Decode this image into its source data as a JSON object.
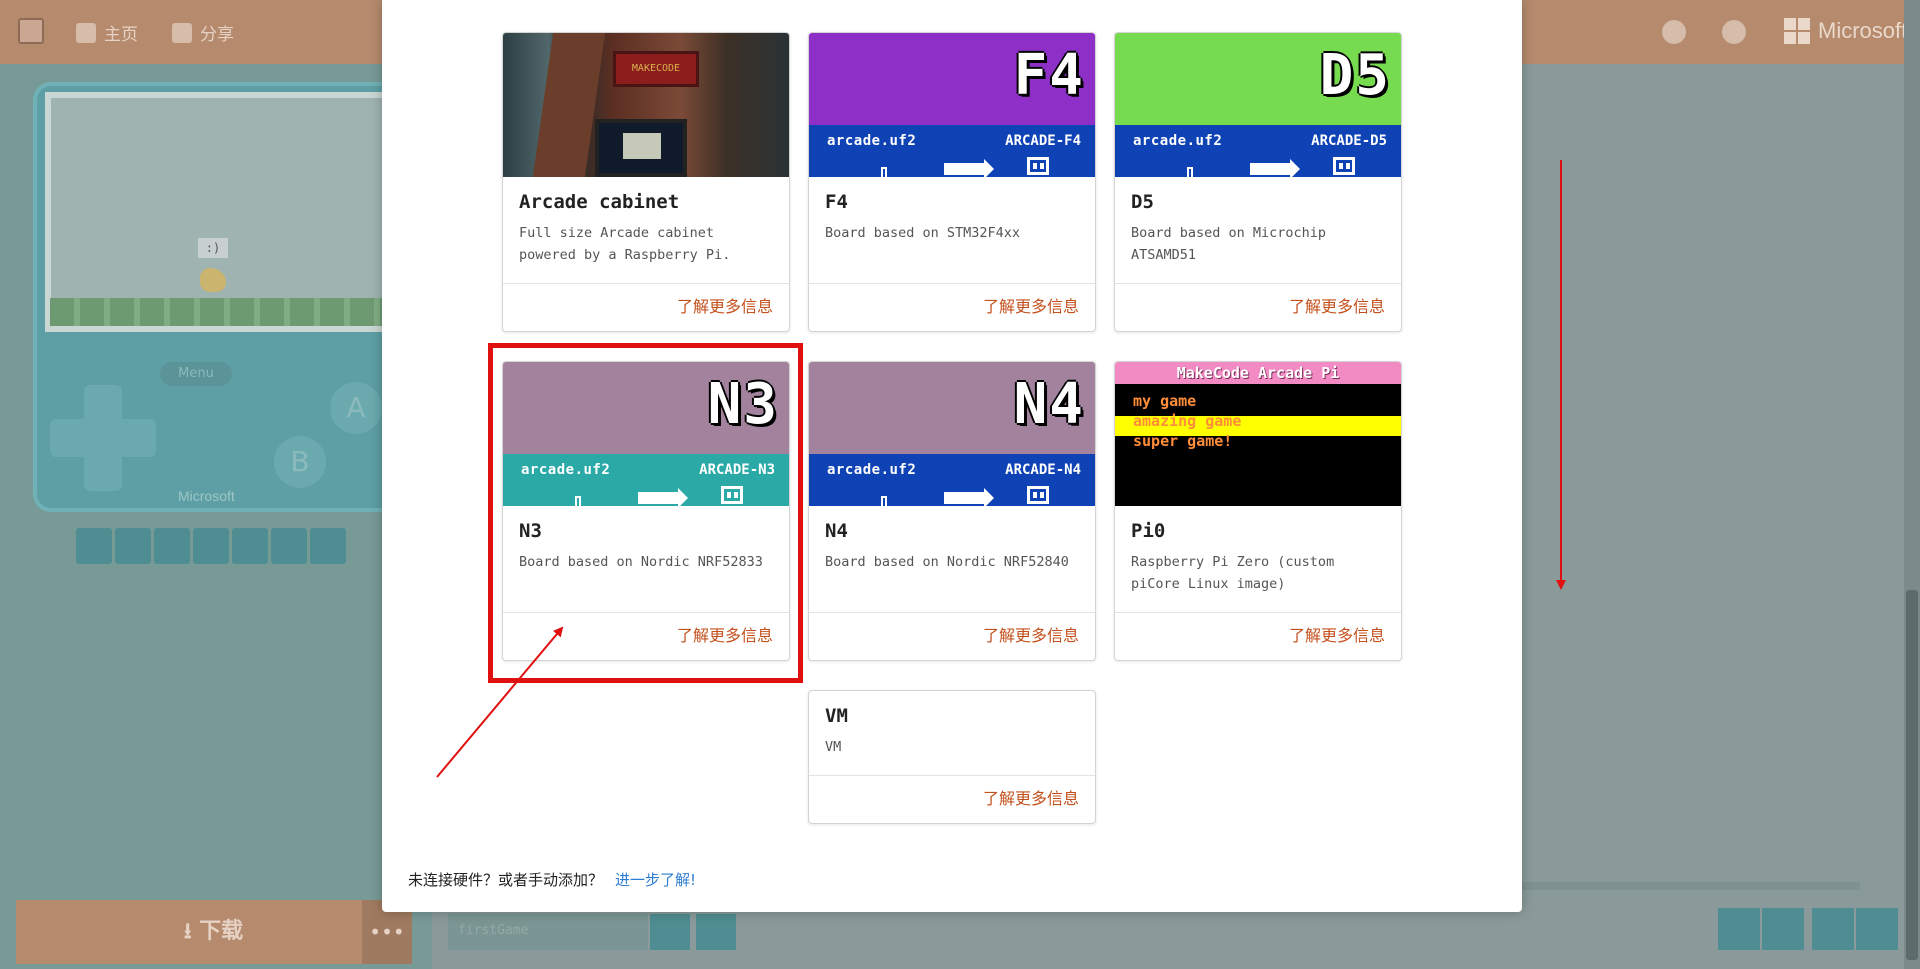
{
  "topbar": {
    "home_label": "主页",
    "share_label": "分享",
    "brand": "Microsoft"
  },
  "simulator": {
    "bubble_text": ":)",
    "menu_label": "Menu",
    "btn_a": "A",
    "btn_b": "B",
    "brand": "Microsoft"
  },
  "bottom": {
    "download_label": "下载",
    "more_label": "•••",
    "project_name": "firstGame"
  },
  "cards": [
    {
      "name": "Arcade cabinet",
      "desc": "Full size Arcade cabinet powered by a Raspberry Pi.",
      "link": "了解更多信息",
      "marquee": "MAKECODE"
    },
    {
      "name": "F4",
      "desc": "Board based on STM32F4xx",
      "link": "了解更多信息",
      "code": "F4",
      "file": "arcade.uf2",
      "drive": "ARCADE-F4",
      "top_color": "#8e2fc8",
      "bottom_color": "#0f42b5"
    },
    {
      "name": "D5",
      "desc": "Board based on Microchip ATSAMD51",
      "link": "了解更多信息",
      "code": "D5",
      "file": "arcade.uf2",
      "drive": "ARCADE-D5",
      "top_color": "#76db4f",
      "bottom_color": "#0f42b5"
    },
    {
      "name": "N3",
      "desc": "Board based on Nordic NRF52833",
      "link": "了解更多信息",
      "code": "N3",
      "file": "arcade.uf2",
      "drive": "ARCADE-N3",
      "top_color": "#a2829c",
      "bottom_color": "#2aa9a7"
    },
    {
      "name": "N4",
      "desc": "Board based on Nordic NRF52840",
      "link": "了解更多信息",
      "code": "N4",
      "file": "arcade.uf2",
      "drive": "ARCADE-N4",
      "top_color": "#a2829c",
      "bottom_color": "#0f42b5"
    },
    {
      "name": "Pi0",
      "desc": "Raspberry Pi Zero (custom piCore Linux image)",
      "link": "了解更多信息",
      "banner": "MakeCode Arcade Pi",
      "lines": [
        "my game",
        "amazing game",
        "super game!"
      ]
    },
    {
      "name": "VM",
      "desc": "VM",
      "link": "了解更多信息"
    }
  ],
  "footer": {
    "text": "未连接硬件？或者手动添加？",
    "link": "进一步了解!"
  },
  "colors": {
    "link": "#c4501c",
    "annotation": "#e01010",
    "learn_more": "#2d7dd2"
  }
}
